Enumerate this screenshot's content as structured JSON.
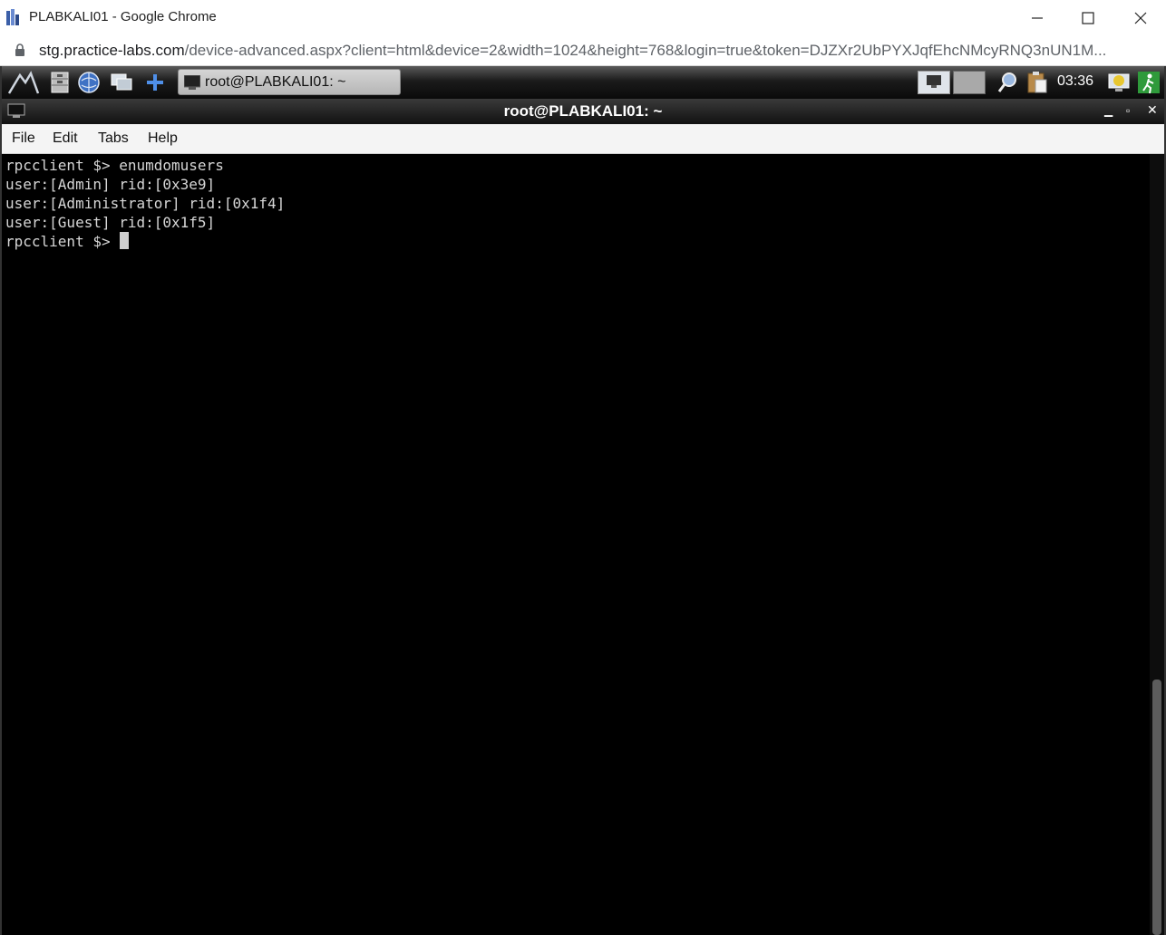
{
  "window": {
    "title": "PLABKALI01 - Google Chrome"
  },
  "address": {
    "url_host": "stg.practice-labs.com",
    "url_path": "/device-advanced.aspx?client=html&device=2&width=1024&height=768&login=true&token=DJZXr2UbPYXJqfEhcNMcyRNQ3nUN1M..."
  },
  "taskbar": {
    "launchers": [
      "kali-menu-icon",
      "file-cabinet-icon",
      "browser-globe-icon",
      "show-desktop-icon",
      "add-plus-icon"
    ],
    "task_label": "root@PLABKALI01: ~",
    "clock": "03:36"
  },
  "terminal_window": {
    "title": "root@PLABKALI01: ~",
    "menu": [
      "File",
      "Edit",
      "Tabs",
      "Help"
    ]
  },
  "terminal": {
    "lines": [
      "rpcclient $> enumdomusers",
      "user:[Admin] rid:[0x3e9]",
      "user:[Administrator] rid:[0x1f4]",
      "user:[Guest] rid:[0x1f5]"
    ],
    "prompt": "rpcclient $> "
  },
  "colors": {
    "terminal_bg": "#000000",
    "terminal_fg": "#d6d6d6"
  }
}
